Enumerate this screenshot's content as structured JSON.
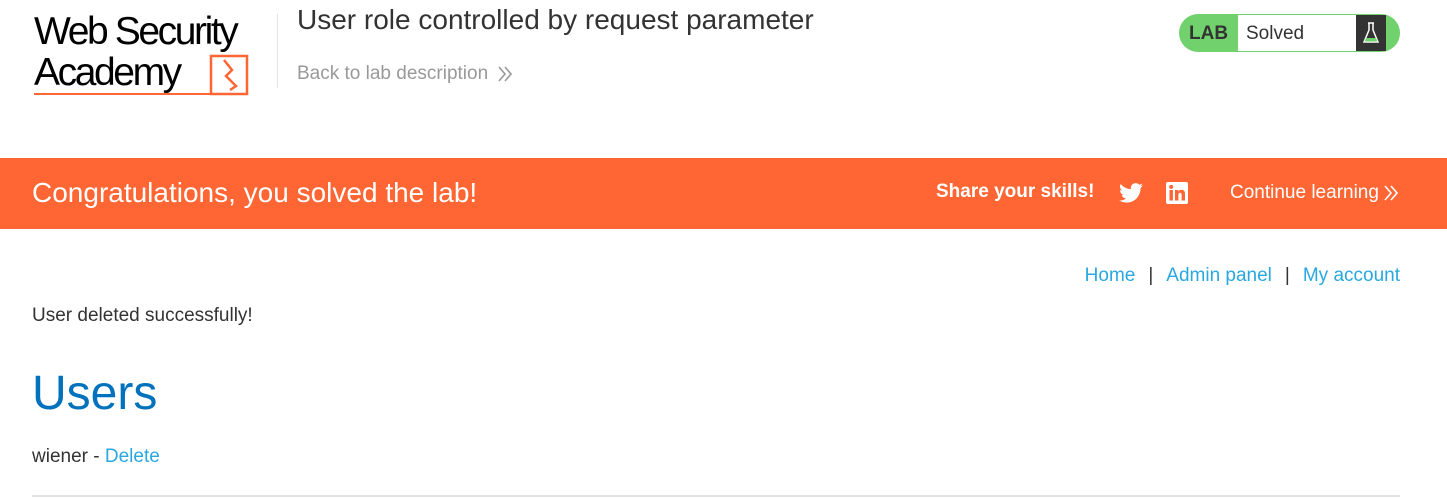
{
  "header": {
    "logo": {
      "line1": "Web Security",
      "line2": "Academy"
    },
    "lab_title": "User role controlled by request parameter",
    "back_link": "Back to lab description"
  },
  "lab_status": {
    "label": "LAB",
    "status": "Solved",
    "icon": "flask-icon",
    "color": "#70d16d"
  },
  "banner": {
    "message": "Congratulations, you solved the lab!",
    "share_label": "Share your skills!",
    "icons": [
      "twitter-icon",
      "linkedin-icon"
    ],
    "continue_label": "Continue learning",
    "color": "#ff6633"
  },
  "nav": {
    "home": "Home",
    "admin_panel": "Admin panel",
    "my_account": "My account",
    "separator": "|"
  },
  "main": {
    "message": "User deleted successfully!",
    "heading": "Users",
    "users": [
      {
        "name": "wiener",
        "separator": " - ",
        "action": "Delete"
      }
    ]
  },
  "colors": {
    "link": "#29a8e0",
    "heading": "#0071bc"
  }
}
